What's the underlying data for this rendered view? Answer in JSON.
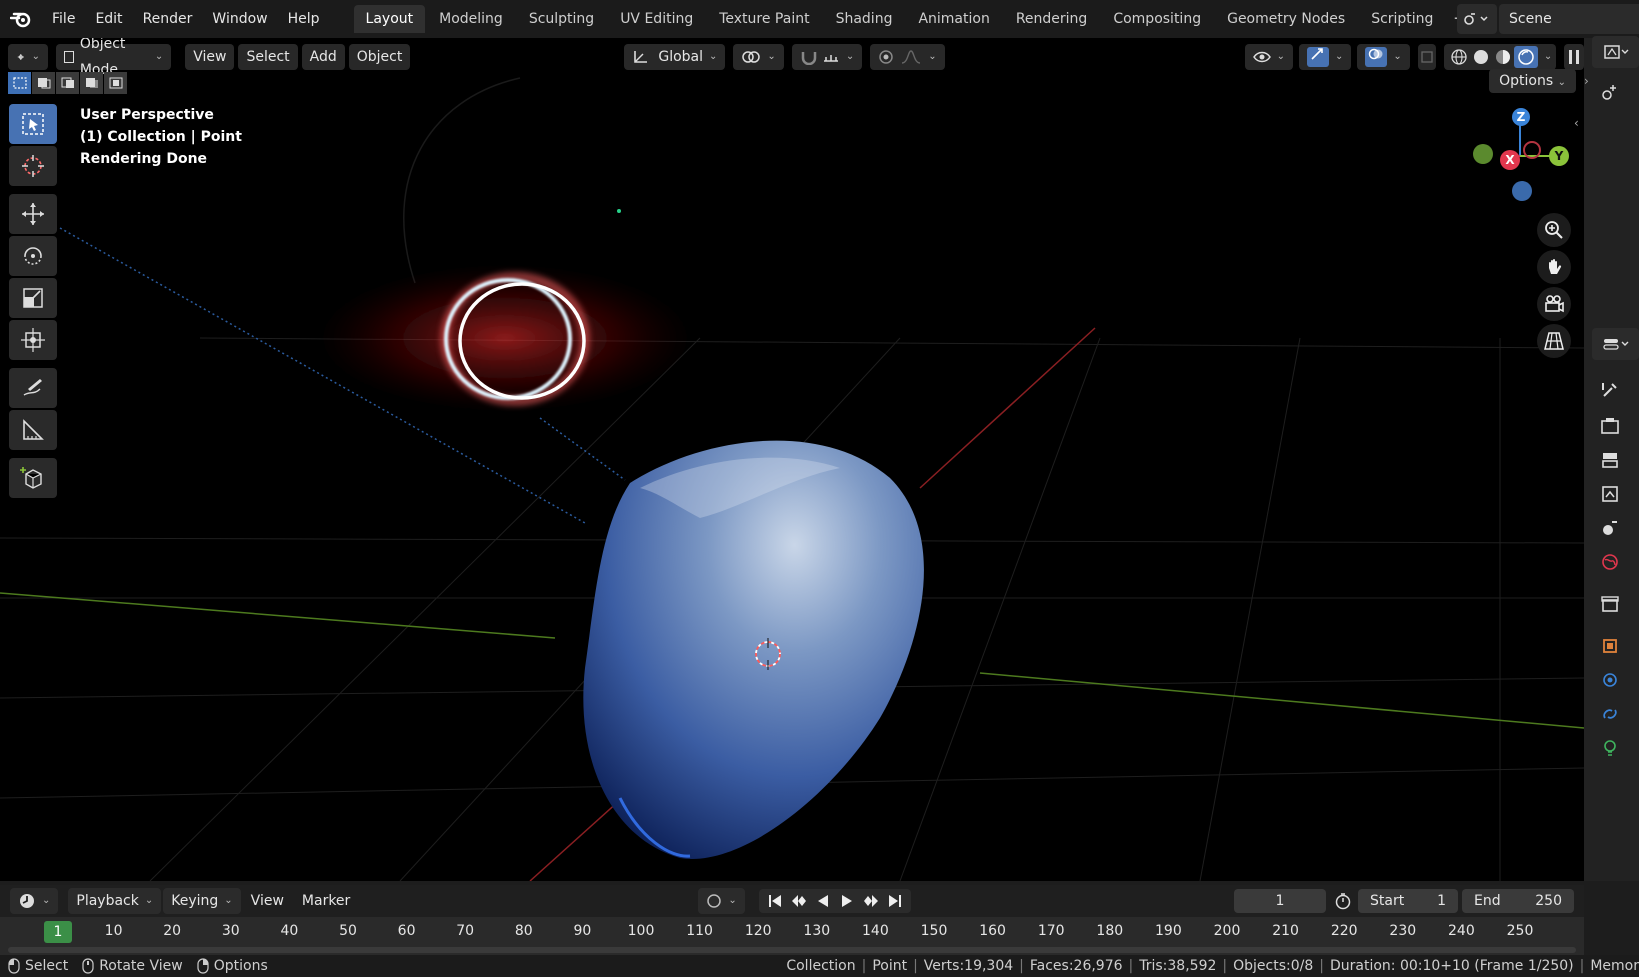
{
  "menu": [
    "File",
    "Edit",
    "Render",
    "Window",
    "Help"
  ],
  "workspaces": [
    {
      "label": "Layout",
      "active": true
    },
    {
      "label": "Modeling"
    },
    {
      "label": "Sculpting"
    },
    {
      "label": "UV Editing"
    },
    {
      "label": "Texture Paint"
    },
    {
      "label": "Shading"
    },
    {
      "label": "Animation"
    },
    {
      "label": "Rendering"
    },
    {
      "label": "Compositing"
    },
    {
      "label": "Geometry Nodes"
    },
    {
      "label": "Scripting"
    }
  ],
  "scene": {
    "name": "Scene"
  },
  "viewport_header": {
    "mode": "Object Mode",
    "menus": [
      "View",
      "Select",
      "Add",
      "Object"
    ],
    "orientation": "Global",
    "options_label": "Options"
  },
  "overlay": {
    "line1": "User Perspective",
    "line2": "(1) Collection | Point",
    "line3": "Rendering Done"
  },
  "gizmo": {
    "z": "Z",
    "y": "Y",
    "x": "X"
  },
  "timeline": {
    "menus": [
      "Playback",
      "Keying",
      "View",
      "Marker"
    ],
    "current_frame": "1",
    "start_label": "Start",
    "start": "1",
    "end_label": "End",
    "end": "250",
    "ruler_current": "1",
    "ruler_ticks": [
      "10",
      "20",
      "30",
      "40",
      "50",
      "60",
      "70",
      "80",
      "90",
      "100",
      "110",
      "120",
      "130",
      "140",
      "150",
      "160",
      "170",
      "180",
      "190",
      "200",
      "210",
      "220",
      "230",
      "240",
      "250"
    ]
  },
  "status": {
    "hint_select": "Select",
    "hint_rotate": "Rotate View",
    "hint_options": "Options",
    "collection": "Collection",
    "object": "Point",
    "verts": "Verts:19,304",
    "faces": "Faces:26,976",
    "tris": "Tris:38,592",
    "objects": "Objects:0/8",
    "duration": "Duration: 00:10+10 (Frame 1/250)",
    "memory": "Memor"
  },
  "colors": {
    "accent": "#4772b3",
    "frame_green": "#3b8f47",
    "axis_x": "#e2374e",
    "axis_y": "#8bc33a",
    "axis_z": "#3a84d9"
  }
}
